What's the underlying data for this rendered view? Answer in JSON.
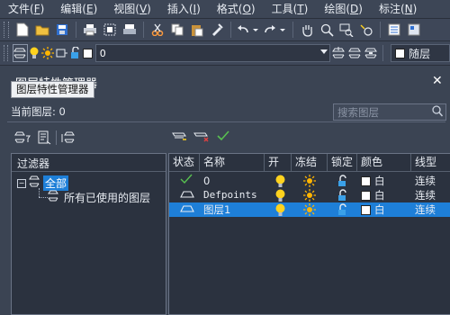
{
  "menubar": {
    "items": [
      {
        "label": "文件(",
        "key": "F",
        "close": ")"
      },
      {
        "label": "编辑(",
        "key": "E",
        "close": ")"
      },
      {
        "label": "视图(",
        "key": "V",
        "close": ")"
      },
      {
        "label": "插入(",
        "key": "I",
        "close": ")"
      },
      {
        "label": "格式(",
        "key": "O",
        "close": ")"
      },
      {
        "label": "工具(",
        "key": "T",
        "close": ")"
      },
      {
        "label": "绘图(",
        "key": "D",
        "close": ")"
      },
      {
        "label": "标注(",
        "key": "N",
        "close": ")"
      }
    ]
  },
  "layer_toolbar": {
    "current_layer_value": "0",
    "color_value": "随层"
  },
  "panel": {
    "title": "图层特性管理器",
    "tooltip": "图层特性管理器",
    "current_layer_label": "当前图层: 0",
    "search_placeholder": "搜索图层"
  },
  "filter": {
    "header": "过滤器",
    "items": [
      {
        "label": "全部",
        "selected": true
      },
      {
        "label": "所有已使用的图层",
        "selected": false
      }
    ]
  },
  "layer_table": {
    "columns": [
      "状态",
      "名称",
      "开",
      "冻结",
      "锁定",
      "颜色",
      "线型"
    ],
    "rows": [
      {
        "status": "current",
        "name": "0",
        "on": true,
        "frozen": false,
        "locked": false,
        "color": "白",
        "linetype": "连续",
        "selected": false
      },
      {
        "status": "layer",
        "name": "Defpoints",
        "on": true,
        "frozen": false,
        "locked": false,
        "color": "白",
        "linetype": "连续",
        "selected": false
      },
      {
        "status": "layer",
        "name": "图层1",
        "on": true,
        "frozen": false,
        "locked": false,
        "color": "白",
        "linetype": "连续",
        "selected": true
      }
    ]
  },
  "colors": {
    "background": "#3b4453",
    "pane": "#2b323f",
    "selection": "#1e7fd8",
    "bulb": "#ffd21e",
    "sun": "#ffb400",
    "lock": "#3aa0e8"
  }
}
